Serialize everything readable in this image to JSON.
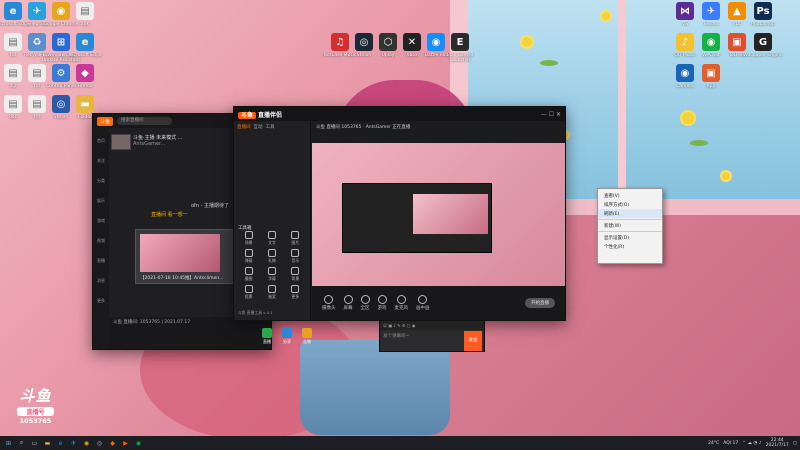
{
  "desktop": {
    "left_icons": [
      {
        "label": "Microsoft Edge",
        "color": "#2a88d8",
        "glyph": "e"
      },
      {
        "label": "Telegram",
        "color": "#2aa0dc",
        "glyph": "✈"
      },
      {
        "label": "Google Chrome",
        "color": "#e6a41f",
        "glyph": "◉"
      },
      {
        "label": "ahk",
        "color": "#eeeeee",
        "glyph": "▤"
      },
      {
        "label": "txt",
        "color": "#eeeeee",
        "glyph": "▤"
      },
      {
        "label": "Recycle Bin",
        "color": "#5a8fc9",
        "glyph": "♻"
      },
      {
        "label": "Windows 10 Update Assistant",
        "color": "#2a6ad8",
        "glyph": "⊞"
      },
      {
        "label": "Microsoft Edge",
        "color": "#2a88d8",
        "glyph": "e"
      },
      {
        "label": "zip",
        "color": "#eeeeee",
        "glyph": "▤"
      },
      {
        "label": "txt",
        "color": "#eeeeee",
        "glyph": "▤"
      },
      {
        "label": "Control Panel",
        "color": "#3a7bd5",
        "glyph": "⚙"
      },
      {
        "label": "Firefox",
        "color": "#c9399a",
        "glyph": "◆"
      },
      {
        "label": "doc",
        "color": "#eeeeee",
        "glyph": "▤"
      },
      {
        "label": "txt",
        "color": "#eeeeee",
        "glyph": "▤"
      },
      {
        "label": "Steam",
        "color": "#2a5aa8",
        "glyph": "◎"
      },
      {
        "label": "Folder",
        "color": "#e7b640",
        "glyph": "▬"
      }
    ],
    "middle_icons": [
      {
        "label": "NetEase Music",
        "color": "#d32f2f",
        "glyph": "♫"
      },
      {
        "label": "Steam",
        "color": "#1b2838",
        "glyph": "◎"
      },
      {
        "label": "Uplay",
        "color": "#333333",
        "glyph": "⬡"
      },
      {
        "label": "Xbox",
        "color": "#222222",
        "glyph": "✕"
      },
      {
        "label": "Battle.net",
        "color": "#148eff",
        "glyph": "◉"
      },
      {
        "label": "Epic Games Launcher",
        "color": "#2b2b2b",
        "glyph": "E"
      }
    ],
    "right_icons": [
      {
        "label": "VS",
        "color": "#5c2d91",
        "glyph": "⋈"
      },
      {
        "label": "Feishu",
        "color": "#3c7cff",
        "glyph": "✈"
      },
      {
        "label": "VLC",
        "color": "#f28c00",
        "glyph": "▲"
      },
      {
        "label": "Photoshop",
        "color": "#0f2d54",
        "glyph": "Ps"
      },
      {
        "label": "QQ Music",
        "color": "#f2c230",
        "glyph": "♪"
      },
      {
        "label": "WeChat",
        "color": "#16b145",
        "glyph": "◉"
      },
      {
        "label": "ToDesk",
        "color": "#e24e2c",
        "glyph": "▣"
      },
      {
        "label": "Wallpaper Engine",
        "color": "#222222",
        "glyph": "G"
      },
      {
        "label": "Camera",
        "color": "#1a64b8",
        "glyph": "◉"
      },
      {
        "label": "App",
        "color": "#e05f2a",
        "glyph": "▣"
      }
    ]
  },
  "chat_window": {
    "search_placeholder": "搜索直播间",
    "room_title": "斗鱼·主播 未来模式 ...",
    "room_sub": "AntsGamer...",
    "messages": [
      "ofn - 主播期待了",
      "直播间 看一想一"
    ],
    "preview_caption": "【2021-07-16 10:45推】Antsclimen...",
    "footer_line": "斗鱼 直播间: 1053765 | 2021.07.17",
    "nav_labels": [
      "首页",
      "关注",
      "分类",
      "娱乐",
      "游戏",
      "视频",
      "直播",
      "消息",
      "更多"
    ]
  },
  "obs_window": {
    "brand": "直播伴侣",
    "tabs": [
      "直播间",
      "互动",
      "工具"
    ],
    "info_line": "斗鱼 直播间 1053765 · AntsGamer 正在直播",
    "tools_title": "工具箱",
    "tools": [
      "场景",
      "文字",
      "图片",
      "弹幕",
      "礼物",
      "音乐",
      "截图",
      "字幕",
      "背景",
      "投票",
      "抽奖",
      "更多"
    ],
    "bottom_note": "斗鱼 直播工具 v 4.1",
    "controls": [
      "摄像头",
      "屏幕",
      "全区",
      "游戏",
      "麦克风",
      "画中画"
    ],
    "start_label": "开始直播"
  },
  "context_menu": {
    "items": [
      "查看(V)",
      "排序方式(O)",
      "刷新(E)",
      "",
      "新建(W)",
      "",
      "显示设置(D)",
      "个性化(R)"
    ]
  },
  "chat_input": {
    "placeholder": "发个弹幕呗~",
    "send_label": "发送"
  },
  "stream_buttons": [
    "直播",
    "分享",
    "礼物"
  ],
  "watermark": {
    "brand": "斗鱼",
    "tag": "直播号",
    "room_number": "1053765"
  },
  "taskbar": {
    "weather": "24°C",
    "aqi": "AQI 17",
    "time": "22:44",
    "date": "2021/7/17"
  }
}
